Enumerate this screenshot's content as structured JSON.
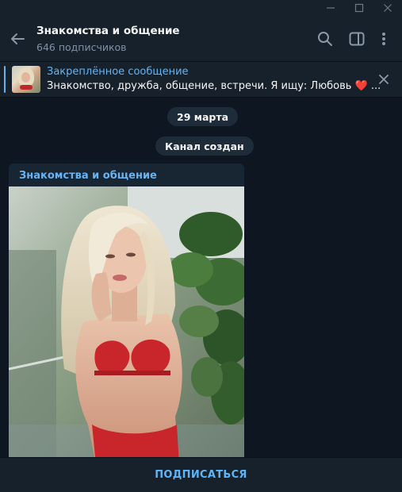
{
  "header": {
    "title": "Знакомства и общение",
    "subtitle": "646 подписчиков"
  },
  "pinned": {
    "title": "Закреплённое сообщение",
    "text": "Знакомство, дружба, общение, встречи.   Я ищу: Любовь",
    "emoji": "❤️",
    "ellipsis": " ..."
  },
  "messages": {
    "date": "29 марта",
    "service_created": "Канал создан",
    "post_author": "Знакомства и общение"
  },
  "footer": {
    "subscribe_label": "ПОДПИСАТЬСЯ"
  },
  "icons": {
    "back": "arrow-left-icon",
    "search": "search-icon",
    "sidebar": "sidebar-toggle-icon",
    "more": "more-vertical-icon",
    "close": "close-icon",
    "minimize": "minimize-icon",
    "maximize": "maximize-icon",
    "window_close": "window-close-icon"
  },
  "colors": {
    "accent": "#5eb5f7",
    "background": "#0e1621",
    "panel": "#17212b",
    "bubble": "#182533"
  }
}
